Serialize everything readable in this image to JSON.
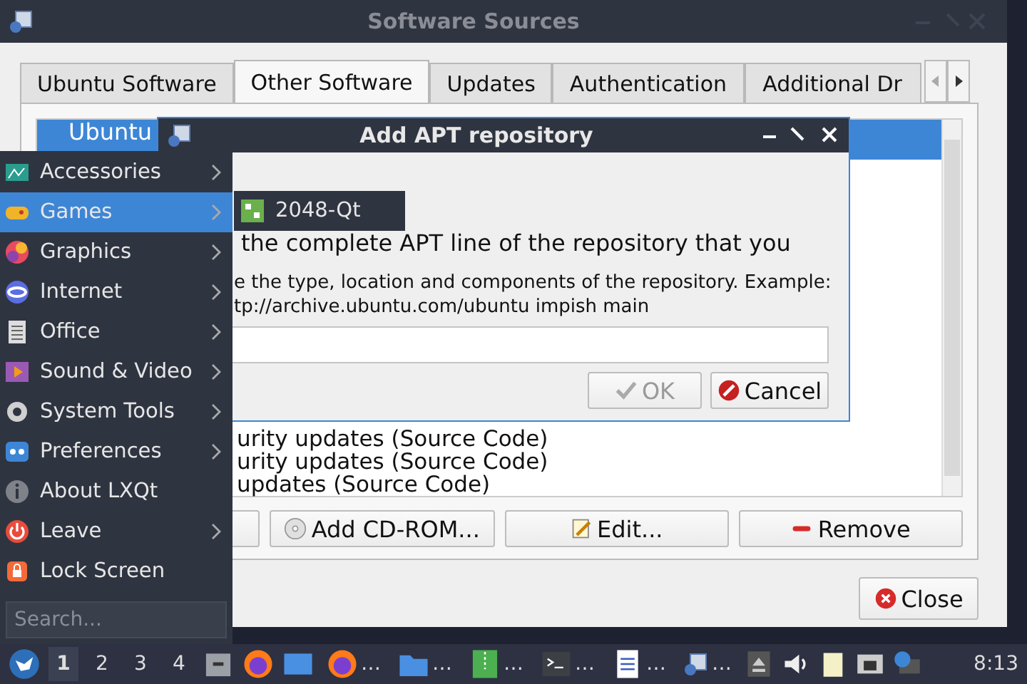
{
  "window": {
    "title": "Software Sources"
  },
  "tabs": [
    {
      "label": "Ubuntu Software",
      "selected": false
    },
    {
      "label": "Other Software",
      "selected": true
    },
    {
      "label": "Updates",
      "selected": false
    },
    {
      "label": "Authentication",
      "selected": false
    },
    {
      "label": "Additional Dr",
      "selected": false
    }
  ],
  "sources": [
    {
      "text": "Ubuntu",
      "selected": true,
      "kind": "top"
    },
    {
      "text": "urity updates (Source Code)",
      "selected": false,
      "kind": "bottom"
    },
    {
      "text": "urity updates (Source Code)",
      "selected": false,
      "kind": "bottom"
    },
    {
      "text": "updates (Source Code)",
      "selected": false,
      "kind": "bottom"
    }
  ],
  "buttons": [
    {
      "label": "Add CD-ROM...",
      "kind": "cdrom"
    },
    {
      "label": "Edit...",
      "kind": "edit"
    },
    {
      "label": "Remove",
      "kind": "remove"
    }
  ],
  "close_button": {
    "label": "Close"
  },
  "dialog": {
    "title": "Add APT repository",
    "prompt": "the complete APT line of the repository that you",
    "hint_lines": [
      "e the type, location and components of the repository. Example:",
      "tp://archive.ubuntu.com/ubuntu impish main"
    ],
    "ok": {
      "label": "OK",
      "disabled": true
    },
    "cancel": {
      "label": "Cancel",
      "disabled": false
    }
  },
  "menu": {
    "items": [
      {
        "label": "Accessories",
        "kind": "submenu",
        "selected": false
      },
      {
        "label": "Games",
        "kind": "submenu",
        "selected": true
      },
      {
        "label": "Graphics",
        "kind": "submenu",
        "selected": false
      },
      {
        "label": "Internet",
        "kind": "submenu",
        "selected": false
      },
      {
        "label": "Office",
        "kind": "submenu",
        "selected": false
      },
      {
        "label": "Sound & Video",
        "kind": "submenu",
        "selected": false
      },
      {
        "label": "System Tools",
        "kind": "submenu",
        "selected": false
      },
      {
        "label": "Preferences",
        "kind": "submenu",
        "selected": false
      },
      {
        "label": "About LXQt",
        "kind": "action",
        "selected": false
      },
      {
        "label": "Leave",
        "kind": "submenu",
        "selected": false
      },
      {
        "label": "Lock Screen",
        "kind": "action",
        "selected": false
      }
    ],
    "search": {
      "placeholder": "Search..."
    }
  },
  "submenu": {
    "items": [
      {
        "label": "2048-Qt"
      }
    ]
  },
  "taskbar": {
    "desktops": [
      {
        "label": "1",
        "selected": true
      },
      {
        "label": "2",
        "selected": false
      },
      {
        "label": "3",
        "selected": false
      },
      {
        "label": "4",
        "selected": false
      }
    ],
    "tasks": [
      {
        "label": "…",
        "kind": "firefox"
      },
      {
        "label": "…",
        "kind": "folder"
      },
      {
        "label": "…",
        "kind": "archive"
      },
      {
        "label": "…",
        "kind": "terminal"
      },
      {
        "label": "…",
        "kind": "document"
      },
      {
        "label": "…",
        "kind": "sources"
      }
    ],
    "clock": "8:13"
  }
}
